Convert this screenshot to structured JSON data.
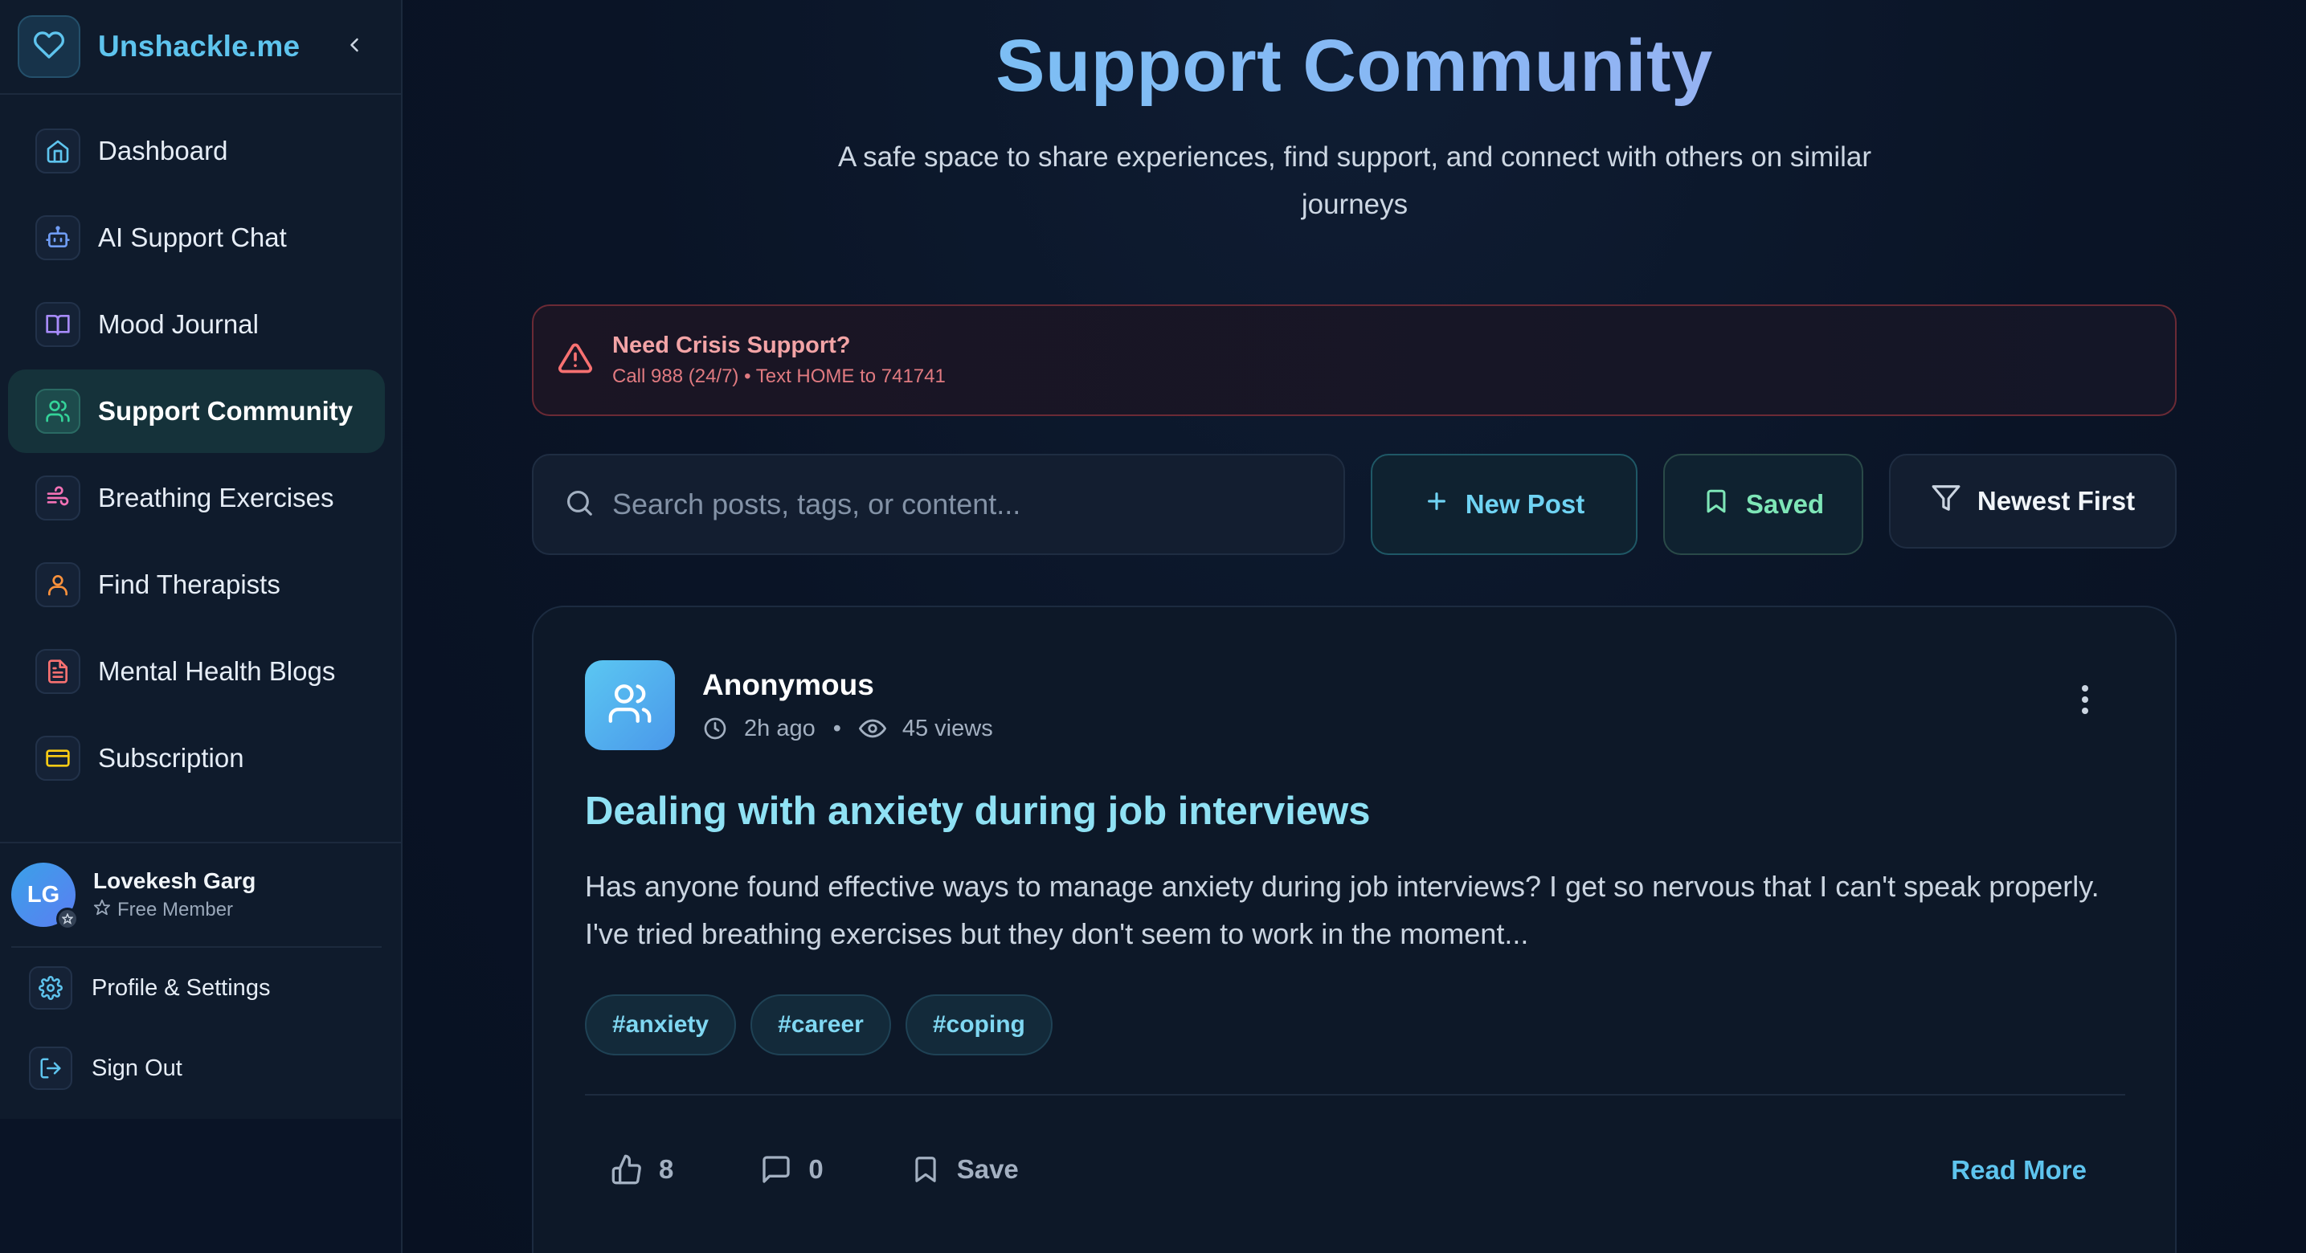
{
  "brand": {
    "name": "Unshackle.me",
    "icon": "heart-icon",
    "color": "#5ec4ee"
  },
  "sidebar": {
    "items": [
      {
        "label": "Dashboard",
        "icon": "home-icon",
        "color": "#5ec4ee"
      },
      {
        "label": "AI Support Chat",
        "icon": "bot-icon",
        "color": "#6f9cf4"
      },
      {
        "label": "Mood Journal",
        "icon": "book-icon",
        "color": "#a78bfa"
      },
      {
        "label": "Support Community",
        "icon": "users-icon",
        "color": "#34d399",
        "active": true
      },
      {
        "label": "Breathing Exercises",
        "icon": "wind-icon",
        "color": "#f472b6"
      },
      {
        "label": "Find Therapists",
        "icon": "user-icon",
        "color": "#fb923c"
      },
      {
        "label": "Mental Health Blogs",
        "icon": "document-icon",
        "color": "#f87171"
      },
      {
        "label": "Subscription",
        "icon": "credit-card-icon",
        "color": "#facc15"
      }
    ],
    "user": {
      "initials": "LG",
      "name": "Lovekesh Garg",
      "plan": "Free Member"
    },
    "footer": [
      {
        "label": "Profile & Settings",
        "icon": "gear-icon"
      },
      {
        "label": "Sign Out",
        "icon": "sign-out-icon"
      }
    ]
  },
  "header": {
    "title": "Support Community",
    "subtitle": "A safe space to share experiences, find support, and connect with others on similar journeys"
  },
  "crisis": {
    "title": "Need Crisis Support?",
    "text": "Call 988 (24/7) • Text HOME to 741741",
    "color": "#f3a4a6"
  },
  "toolbar": {
    "search_placeholder": "Search posts, tags, or content...",
    "new_post": "New Post",
    "saved": "Saved",
    "sort": "Newest First"
  },
  "post": {
    "author": "Anonymous",
    "time": "2h ago",
    "views": "45 views",
    "title": "Dealing with anxiety during job interviews",
    "body": "Has anyone found effective ways to manage anxiety during job interviews? I get so nervous that I can't speak properly. I've tried breathing exercises but they don't seem to work in the moment...",
    "tags": [
      "#anxiety",
      "#career",
      "#coping"
    ],
    "likes": "8",
    "comments": "0",
    "save_label": "Save",
    "read_more": "Read More"
  }
}
